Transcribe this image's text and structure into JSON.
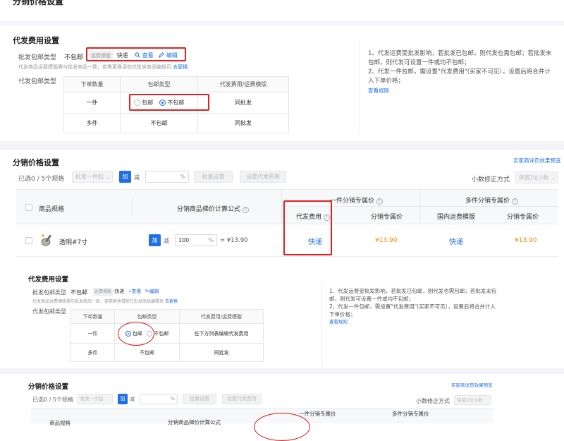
{
  "top_cut_title": "分销价格设置",
  "a": {
    "title": "代发费用设置",
    "type_label": "批发包邮类型",
    "type_value": "不包邮",
    "tag_text": "运费模版",
    "tag_value": "快递",
    "view_label": "查看",
    "edit_label": "编辑",
    "hint_text": "代发商品运费模版需与批发商品一致，若需更换请前往批发商品编辑页",
    "hint_link": "去更换",
    "dropship_type_label": "代发包邮类型",
    "tbl_headers": [
      "下单数量",
      "包邮类型",
      "代发费用/运费模版"
    ],
    "row1_qty": "一件",
    "opt_free": "包邮",
    "opt_nofree": "不包邮",
    "row1_fee": "同批发",
    "row2_qty": "多件",
    "row2_type": "不包邮",
    "row2_fee": "同批发",
    "note1": "1、代发运费受批发影响，若批发已包邮，则代发也需包邮；若批发未包邮，则代发可设置一件或均不包邮；",
    "note2": "2、代发一件包邮，需设置\"代发费用\"(买家不可见），设置后将合并计入下单价格；",
    "note_link": "查看规则"
  },
  "b": {
    "title": "分销价格设置",
    "preview_link": "买家商详页效果预览",
    "selected": "已选0 / 5个规格",
    "batch_select": "批发一件起",
    "seg_add": "加",
    "seg_sub": "减",
    "pct": "%",
    "batch_set": "批量设置",
    "set_fee": "设置代发费用",
    "decimal_label": "小数修正方式",
    "decimal_select": "保留2位小数",
    "col_spec": "商品规格",
    "col_formula": "分销商品梯价计算公式",
    "grp_single": "一件分销专属价",
    "grp_multi": "多件分销专属价",
    "col_fee": "代发费用",
    "col_price1": "分销专属价",
    "col_tpl": "国内运费模版",
    "col_price2": "分销专属价",
    "row_spec": "透明#7寸",
    "row_pct_val": "100",
    "row_result": "= ¥13.90",
    "row_fee": "快递",
    "row_price1": "¥13.90",
    "row_tpl": "快递",
    "row_price2": "¥13.90"
  },
  "c": {
    "title": "代发费用设置",
    "type_label": "批发包邮类型",
    "type_value": "不包邮",
    "tag_text": "运费模版",
    "tag_value": "快递",
    "view_label": "查看",
    "edit_label": "编辑",
    "hint_text": "代发商品运费模版需与批发商品一致，若需更换请前往批发商品编辑页",
    "hint_link": "去更换",
    "dropship_type_label": "代发包邮类型",
    "tbl_headers": [
      "下单数量",
      "包邮类型",
      "代发费用/运费模版"
    ],
    "row1_qty": "一件",
    "opt_free": "包邮",
    "opt_nofree": "不包邮",
    "row1_fee": "在下方列表编辑代发费用",
    "row2_qty": "多件",
    "row2_type": "不包邮",
    "row2_fee": "同批发",
    "note1": "1、代发运费受批发影响，若批发已包邮，则代发也需包邮；若批发未包邮，则代发可设置一件或均不包邮；",
    "note2": "2、代发一件包邮，需设置\"代发费用\"(买家不可见），设置后将合并计入下单价格；",
    "note_link": "查看规则"
  },
  "d": {
    "title": "分销价格设置",
    "preview_link": "买家商详页效果预览",
    "selected": "已选0 / 5个规格",
    "batch_select": "批发一件起",
    "seg_add": "加",
    "seg_sub": "减",
    "pct": "%",
    "batch_set": "批量设置",
    "set_fee": "设置代发费用",
    "decimal_label": "小数修正方式",
    "decimal_select": "保留2位小数",
    "col_spec": "商品规格",
    "col_formula": "分销商品梯价计算公式",
    "grp_single": "一件分销专属价",
    "grp_multi": "多件分销专属价"
  },
  "icons": {
    "help": "?",
    "search": "search-icon",
    "edit": "edit-icon"
  },
  "colors": {
    "accent": "#1f6fe5",
    "price": "#f08a00",
    "highlight": "#e02020"
  }
}
